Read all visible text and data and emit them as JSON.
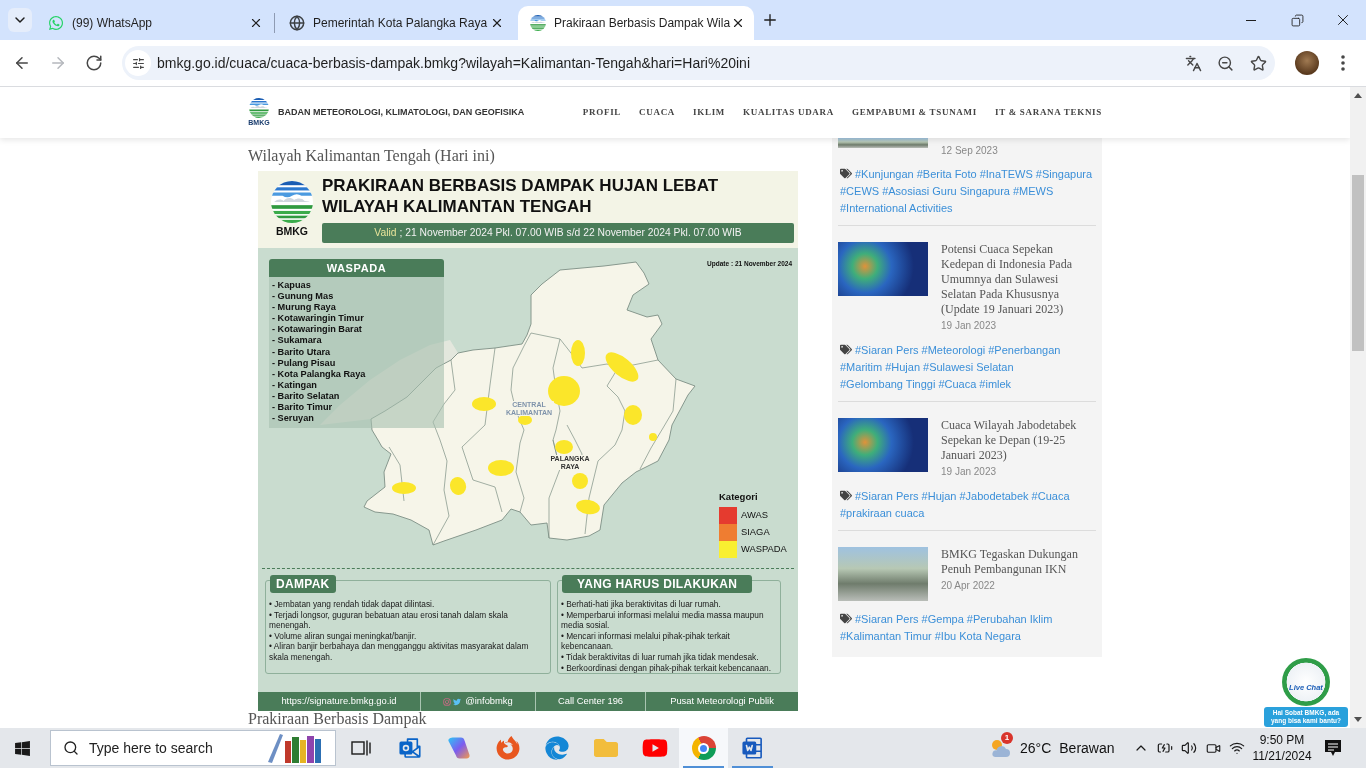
{
  "browser": {
    "tabs": [
      {
        "kind": "chat",
        "title": "(99) WhatsApp",
        "selected": false
      },
      {
        "kind": "globe",
        "title": "Pemerintah Kota Palangka Raya",
        "selected": false
      },
      {
        "kind": "logo",
        "title": "Prakiraan Berbasis Dampak Wila",
        "selected": true
      }
    ],
    "nav_buttons": [
      {
        "kind": "back",
        "disabled": false
      },
      {
        "kind": "forward",
        "disabled": true
      },
      {
        "kind": "reload",
        "disabled": false
      }
    ],
    "url": "bmkg.go.id/cuaca/cuaca-berbasis-dampak.bmkg?wilayah=Kalimantan-Tengah&hari=Hari%20ini"
  },
  "site_header": {
    "logo_text": "BMKG",
    "org_name": "BADAN METEOROLOGI, KLIMATOLOGI, DAN GEOFISIKA",
    "nav": [
      "PROFIL",
      "CUACA",
      "IKLIM",
      "KUALITAS UDARA",
      "GEMPABUMI & TSUNAMI",
      "IT & SARANA TEKNIS"
    ]
  },
  "main": {
    "heading": "Wilayah Kalimantan Tengah (Hari ini)",
    "infographic": {
      "logo_text": "BMKG",
      "title": "PRAKIRAAN BERBASIS DAMPAK HUJAN LEBAT WILAYAH KALIMANTAN TENGAH",
      "valid_label": "Valid",
      "valid_period": "; 21 November 2024 Pkl. 07.00 WIB s/d 22 November 2024 Pkl. 07.00 WIB",
      "update": "Update : 21 November 2024",
      "alert_list": {
        "heading": "WASPADA",
        "regions": [
          "- Kapuas",
          "- Gunung Mas",
          "- Murung Raya",
          "- Kotawaringin Timur",
          "- Kotawaringin Barat",
          "- Sukamara",
          "- Barito Utara",
          "- Pulang Pisau",
          "- Kota Palangka Raya",
          "- Katingan",
          "- Barito Selatan",
          "- Barito Timur",
          "- Seruyan"
        ]
      },
      "map_labels": [
        "CENTRAL KALIMANTAN",
        "PALANGKA RAYA"
      ],
      "legend": {
        "title": "Kategori",
        "items": [
          {
            "label": "AWAS",
            "color": "#e53b2f"
          },
          {
            "label": "SIAGA",
            "color": "#ef7d31"
          },
          {
            "label": "WASPADA",
            "color": "#f9ef30"
          }
        ]
      },
      "panels": [
        {
          "heading": "DAMPAK",
          "items": [
            "• Jembatan yang rendah tidak dapat dilintasi.",
            "• Terjadi longsor, guguran bebatuan atau erosi tanah dalam skala menengah.",
            "• Volume aliran sungai meningkat/banjir.",
            "• Aliran banjir berbahaya dan mengganggu aktivitas masyarakat dalam skala menengah."
          ]
        },
        {
          "heading": "YANG HARUS DILAKUKAN",
          "items": [
            "• Berhati-hati jika beraktivitas di luar rumah.",
            "• Memperbarui informasi melalui media massa maupun media sosial.",
            "• Mencari informasi melalui pihak-pihak terkait kebencanaan.",
            "• Tidak beraktivitas di luar rumah jika tidak mendesak.",
            "• Berkoordinasi dengan pihak-pihak terkait kebencanaan."
          ]
        }
      ],
      "footer": [
        {
          "kind": "link",
          "text": "https://signature.bmkg.go.id"
        },
        {
          "kind": "social",
          "text": "@infobmkg"
        },
        {
          "kind": "text",
          "text": "Call Center 196"
        },
        {
          "kind": "text",
          "text": "Pusat Meteorologi Publik"
        }
      ]
    },
    "next_heading": "Prakiraan Berbasis Dampak"
  },
  "sidebar": {
    "posts": [
      {
        "kind": "photo",
        "date": "12 Sep 2023",
        "tags": [
          "#Kunjungan",
          "#Berita Foto",
          "#InaTEWS",
          "#Singapura",
          "#CEWS",
          "#Asosiasi Guru Singapura",
          "#MEWS",
          "#International Activities"
        ]
      },
      {
        "kind": "radar",
        "title": "Potensi Cuaca Sepekan Kedepan di Indonesia Pada Umumnya dan Sulawesi Selatan Pada Khususnya (Update 19 Januari 2023)",
        "date": "19 Jan 2023",
        "tags": [
          "#Siaran Pers",
          "#Meteorologi",
          "#Penerbangan",
          "#Maritim",
          "#Hujan",
          "#Sulawesi Selatan",
          "#Gelombang Tinggi",
          "#Cuaca",
          "#imlek"
        ]
      },
      {
        "kind": "radar",
        "title": "Cuaca Wilayah Jabodetabek Sepekan ke Depan (19-25 Januari 2023)",
        "date": "19 Jan 2023",
        "tags": [
          "#Siaran Pers",
          "#Hujan",
          "#Jabodetabek",
          "#Cuaca",
          "#prakiraan cuaca"
        ]
      },
      {
        "kind": "photo",
        "title": "BMKG Tegaskan Dukungan Penuh Pembangunan IKN",
        "date": "20 Apr 2022",
        "tags": [
          "#Siaran Pers",
          "#Gempa",
          "#Perubahan Iklim",
          "#Kalimantan Timur",
          "#Ibu Kota Negara"
        ]
      }
    ]
  },
  "live_chat": {
    "label": "Live Chat",
    "bubble": "Hai Sobat BMKG, ada yang bisa kami bantu?"
  },
  "taskbar": {
    "search_placeholder": "Type here to search",
    "apps": [
      {
        "kind": "taskview",
        "running": false,
        "selected": false
      },
      {
        "kind": "outlook",
        "running": false,
        "selected": false
      },
      {
        "kind": "copilot",
        "running": false,
        "selected": false
      },
      {
        "kind": "firefox",
        "running": false,
        "selected": false
      },
      {
        "kind": "edge",
        "running": false,
        "selected": false
      },
      {
        "kind": "explorer",
        "running": false,
        "selected": false
      },
      {
        "kind": "youtube",
        "running": false,
        "selected": false
      },
      {
        "kind": "chrome",
        "running": true,
        "selected": true
      },
      {
        "kind": "word",
        "running": true,
        "selected": false
      }
    ],
    "weather": {
      "badge": "1",
      "temperature": "26°C",
      "condition": "Berawan"
    },
    "time": "9:50 PM",
    "date": "11/21/2024"
  }
}
